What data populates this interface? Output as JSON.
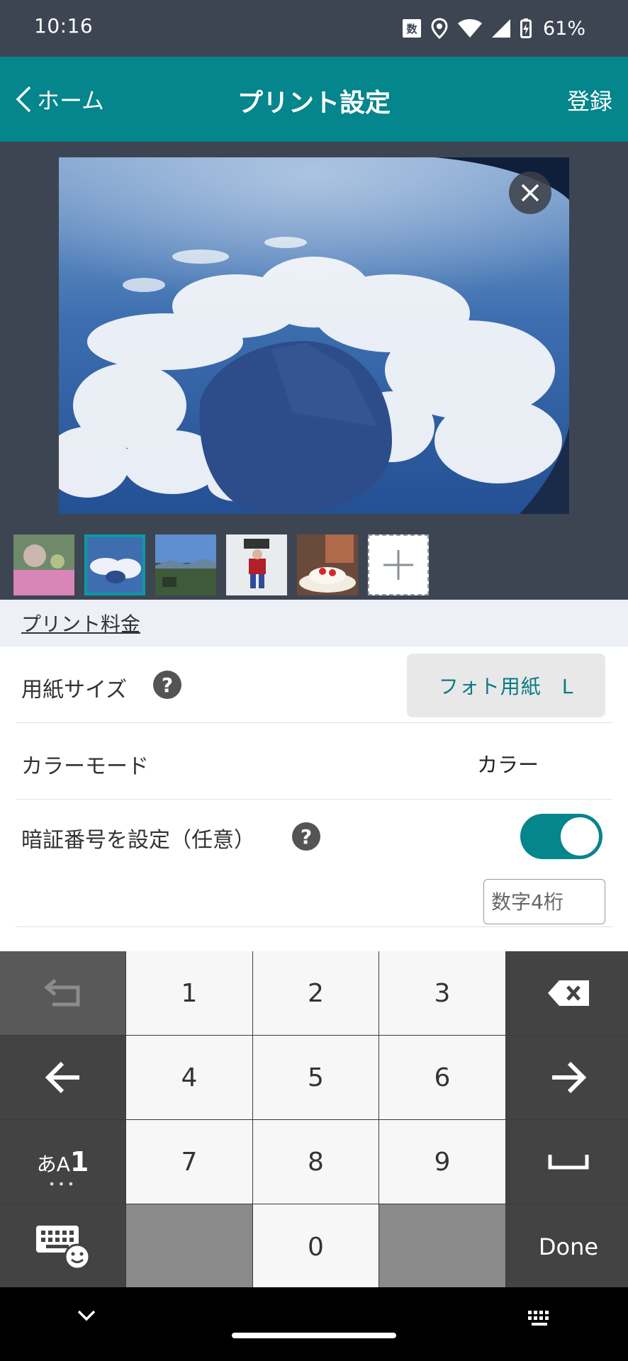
{
  "status_bar": {
    "time": "10:16",
    "ime_indicator": "数",
    "battery": "61%",
    "icons": [
      "location-icon",
      "wifi-icon",
      "signal-icon",
      "battery-charging-icon"
    ]
  },
  "app_bar": {
    "back_label": "ホーム",
    "title": "プリント設定",
    "register_label": "登録"
  },
  "preview": {
    "thumbnail_count": 5,
    "selected_thumbnail": 2
  },
  "settings": {
    "price_link": "プリント料金",
    "paper_size_label": "用紙サイズ",
    "paper_size_value": "フォト用紙　L",
    "color_mode_label": "カラーモード",
    "color_mode_value": "カラー",
    "pin_label": "暗証番号を設定（任意）",
    "pin_enabled": true,
    "pin_placeholder": "数字4桁",
    "help_glyph": "?"
  },
  "keyboard": {
    "digits": [
      "1",
      "2",
      "3",
      "4",
      "5",
      "6",
      "7",
      "8",
      "9",
      "0"
    ],
    "mode_label_kana": "あA",
    "mode_label_num": "1",
    "mode_dots": "•••",
    "done_label": "Done"
  },
  "colors": {
    "app_bar": "#05858c",
    "background": "#3d4553",
    "accent_text": "#0a7b82"
  }
}
